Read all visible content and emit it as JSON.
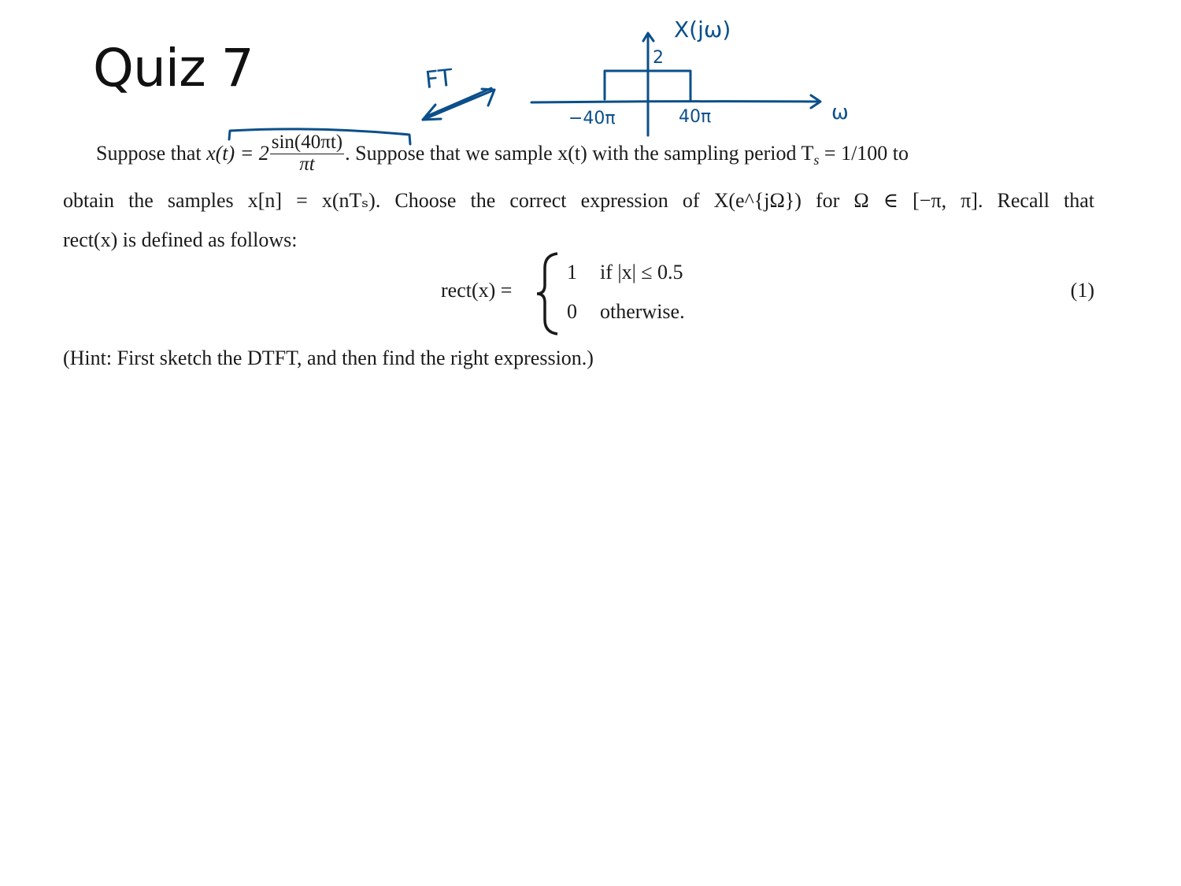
{
  "title": "Quiz 7",
  "annotations": {
    "ft_label": "FT",
    "spectrum_label": "X(jω)",
    "height_label": "2",
    "left_label": "−40π",
    "right_label": "40π",
    "axis_label": "ω",
    "ink_color": "#0b4f8a"
  },
  "problem": {
    "line1_lead": "Suppose that ",
    "line1_x": "x(t) = 2",
    "frac_num": "sin(40πt)",
    "frac_den": "πt",
    "line1_tail": ". Suppose that we sample x(t) with the sampling period T",
    "line1_sub": "s",
    "line1_end": " = 1/100 to",
    "line2": "obtain the samples x[n] = x(nTₛ). Choose the correct expression of X(e^{jΩ}) for Ω ∈ [−π, π]. Recall that",
    "line3": "rect(x) is defined as follows:",
    "eq_lhs": "rect(x) =",
    "case1_val": "1",
    "case1_cond": "if |x| ≤ 0.5",
    "case2_val": "0",
    "case2_cond": "otherwise.",
    "eq_number": "(1)",
    "hint": "(Hint: First sketch the DTFT, and then find the right expression.)"
  }
}
